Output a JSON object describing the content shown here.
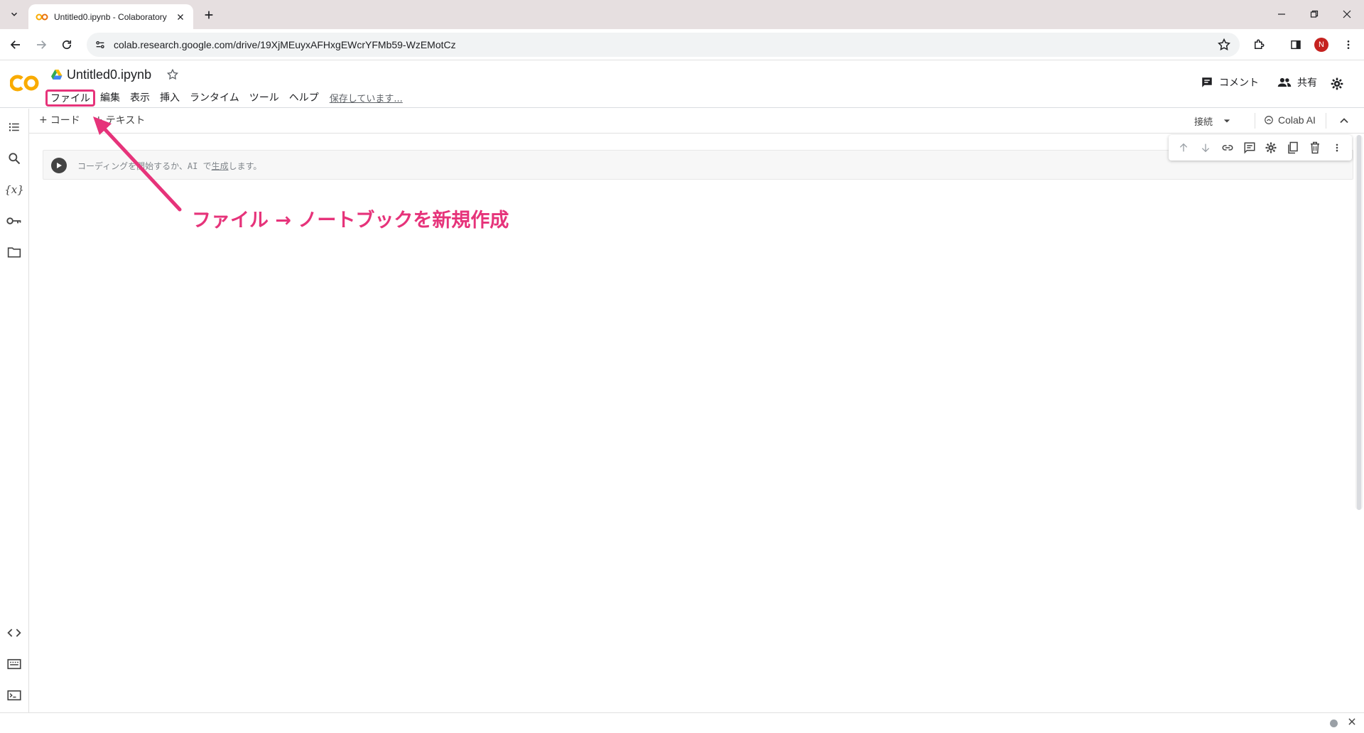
{
  "browser": {
    "tab_title": "Untitled0.ipynb - Colaboratory",
    "url": "colab.research.google.com/drive/19XjMEuyxAFHxgEWcrYFMb59-WzEMotCz",
    "profile_initial": "N"
  },
  "colab": {
    "logo": "CO",
    "notebook_title": "Untitled0.ipynb",
    "menu": [
      {
        "label": "ファイル"
      },
      {
        "label": "編集"
      },
      {
        "label": "表示"
      },
      {
        "label": "挿入"
      },
      {
        "label": "ランタイム"
      },
      {
        "label": "ツール"
      },
      {
        "label": "ヘルプ"
      }
    ],
    "saving_status": "保存しています...",
    "comment_label": "コメント",
    "share_label": "共有"
  },
  "toolbar": {
    "add_code": "コード",
    "add_text": "テキスト",
    "connect": "接続",
    "colab_ai": "Colab AI"
  },
  "cell": {
    "placeholder_prefix": "コーディングを開始するか、AI で",
    "placeholder_link": "生成",
    "placeholder_suffix": "します。"
  },
  "annotation": {
    "text": "ファイル → ノートブックを新規作成",
    "color": "#e6337a"
  },
  "colors": {
    "accent_orange": "#f9ab00",
    "highlight_pink": "#e6337a",
    "tab_strip": "#e6dfe0"
  },
  "icons": [
    "chevron-down-icon",
    "colab-favicon",
    "close-icon",
    "plus-icon",
    "minimize-icon",
    "restore-icon",
    "back-icon",
    "forward-icon",
    "reload-icon",
    "site-info-icon",
    "star-icon",
    "extensions-icon",
    "side-panel-icon",
    "more-vert-icon",
    "drive-icon",
    "comment-icon",
    "people-icon",
    "gear-icon",
    "toc-icon",
    "search-icon",
    "variables-icon",
    "key-icon",
    "folder-icon",
    "code-icon",
    "terminal-icon",
    "command-palette-icon",
    "play-icon",
    "arrow-up-icon",
    "arrow-down-icon",
    "link-icon",
    "comment-cell-icon",
    "settings-cell-icon",
    "mirror-icon",
    "trash-icon"
  ]
}
